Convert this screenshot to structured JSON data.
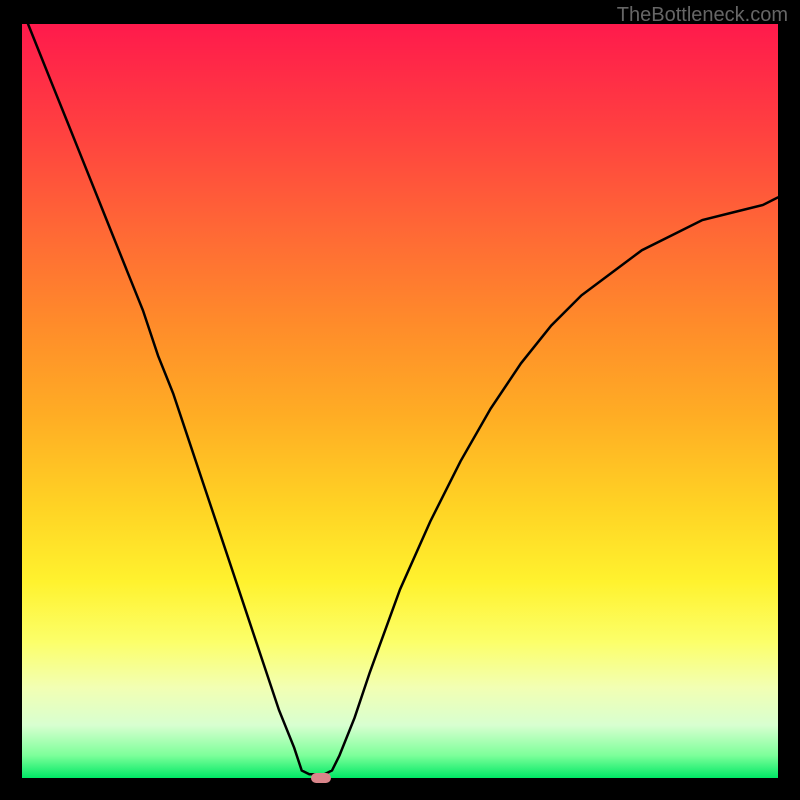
{
  "watermark": "TheBottleneck.com",
  "chart_data": {
    "type": "line",
    "title": "",
    "xlabel": "",
    "ylabel": "",
    "x": [
      0,
      0.02,
      0.04,
      0.06,
      0.08,
      0.1,
      0.12,
      0.14,
      0.16,
      0.18,
      0.2,
      0.22,
      0.24,
      0.26,
      0.28,
      0.3,
      0.32,
      0.34,
      0.36,
      0.37,
      0.38,
      0.39,
      0.4,
      0.41,
      0.42,
      0.44,
      0.46,
      0.5,
      0.54,
      0.58,
      0.62,
      0.66,
      0.7,
      0.74,
      0.78,
      0.82,
      0.86,
      0.9,
      0.94,
      0.98,
      1.0
    ],
    "values": [
      1.02,
      0.97,
      0.92,
      0.87,
      0.82,
      0.77,
      0.72,
      0.67,
      0.62,
      0.56,
      0.51,
      0.45,
      0.39,
      0.33,
      0.27,
      0.21,
      0.15,
      0.09,
      0.04,
      0.01,
      0.005,
      0.005,
      0.005,
      0.01,
      0.03,
      0.08,
      0.14,
      0.25,
      0.34,
      0.42,
      0.49,
      0.55,
      0.6,
      0.64,
      0.67,
      0.7,
      0.72,
      0.74,
      0.75,
      0.76,
      0.77
    ],
    "xlim": [
      0,
      1
    ],
    "ylim": [
      0,
      1
    ],
    "minimum_x": 0.39,
    "background_gradient": {
      "top": "#ff1a4c",
      "bottom": "#00e865",
      "description": "red-orange-yellow-green vertical gradient"
    },
    "marker": {
      "x": 0.395,
      "y": 0.0,
      "color": "#d9858a",
      "shape": "rounded-rect"
    }
  }
}
